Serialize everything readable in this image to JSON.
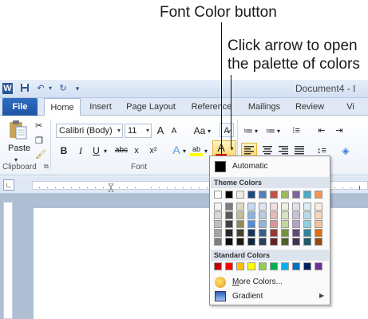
{
  "callouts": {
    "font_color_button": "Font Color button",
    "arrow_line1": "Click arrow to open",
    "arrow_line2": "the palette of colors"
  },
  "window": {
    "app_icon": "W",
    "title": "Document4 - I",
    "quick_access": [
      "save-icon",
      "undo-icon",
      "redo-icon",
      "customize-icon"
    ]
  },
  "tabs": [
    "File",
    "Home",
    "Insert",
    "Page Layout",
    "Reference",
    "Mailings",
    "Review",
    "Vi"
  ],
  "ribbon": {
    "clipboard": {
      "paste_label": "Paste",
      "group_label": "Clipboard"
    },
    "font": {
      "font_name": "Calibri (Body)",
      "font_size": "11",
      "grow_label": "A",
      "shrink_label": "A",
      "case_label": "Aa",
      "bold": "B",
      "italic": "I",
      "underline": "U",
      "strike": "abc",
      "subscript": "x",
      "text_effects": "A",
      "highlight": "ab",
      "font_color": "A",
      "group_label": "Font"
    },
    "paragraph": {
      "bullets": "≔",
      "numbering": "≔"
    }
  },
  "palette": {
    "automatic_label": "Automatic",
    "theme_header": "Theme Colors",
    "standard_header": "Standard Colors",
    "more_colors_label": "More Colors...",
    "gradient_label": "Gradient",
    "theme_top": [
      "#ffffff",
      "#000000",
      "#eeece1",
      "#1f497d",
      "#4f81bd",
      "#c0504d",
      "#9bbb59",
      "#8064a2",
      "#4bacc6",
      "#f79646"
    ],
    "theme_shades": [
      [
        "#f2f2f2",
        "#7f7f7f",
        "#ddd9c3",
        "#c6d9f0",
        "#dbe5f1",
        "#f2dcdb",
        "#ebf1dd",
        "#e5e0ec",
        "#dbeef3",
        "#fdeada"
      ],
      [
        "#d8d8d8",
        "#595959",
        "#c4bd97",
        "#8db3e2",
        "#b8cce4",
        "#e5b9b7",
        "#d7e3bc",
        "#ccc1d9",
        "#b7dde8",
        "#fbd5b5"
      ],
      [
        "#bfbfbf",
        "#3f3f3f",
        "#938953",
        "#548dd4",
        "#95b3d7",
        "#d99694",
        "#c3d69b",
        "#b2a2c7",
        "#92cddc",
        "#fac08f"
      ],
      [
        "#a5a5a5",
        "#262626",
        "#494429",
        "#17365d",
        "#366092",
        "#953734",
        "#76923c",
        "#5f497a",
        "#31859b",
        "#e36c09"
      ],
      [
        "#7f7f7f",
        "#0c0c0c",
        "#1d1b10",
        "#0f243e",
        "#244061",
        "#632423",
        "#4f6128",
        "#3f3151",
        "#205867",
        "#974806"
      ]
    ],
    "standard": [
      "#c00000",
      "#ff0000",
      "#ffc000",
      "#ffff00",
      "#92d050",
      "#00b050",
      "#00b0f0",
      "#0070c0",
      "#002060",
      "#7030a0"
    ]
  }
}
